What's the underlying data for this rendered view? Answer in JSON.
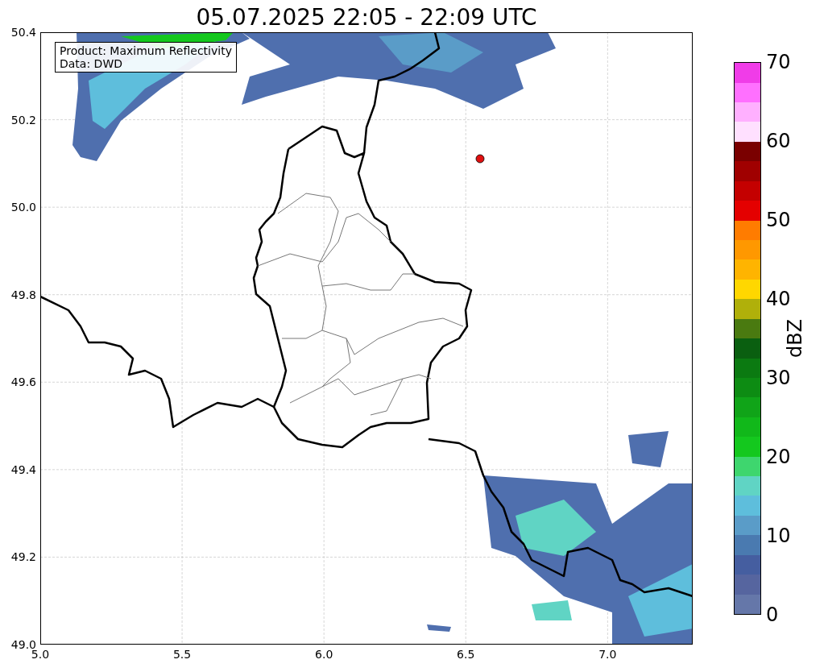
{
  "title": "05.07.2025 22:05 - 22:09 UTC",
  "legend": [
    "Product: Maximum Reflectivity",
    "Data: DWD"
  ],
  "map": {
    "xticks": [
      "5.0",
      "5.5",
      "6.0",
      "6.5",
      "7.0"
    ],
    "yticks": [
      "50.4",
      "50.2",
      "50.0",
      "49.8",
      "49.6",
      "49.4",
      "49.2",
      "49.0"
    ]
  },
  "colorbar": {
    "label": "dBZ",
    "ticks": [
      "70",
      "60",
      "50",
      "40",
      "30",
      "20",
      "10",
      "0"
    ],
    "bands": [
      {
        "color": "#6577a9"
      },
      {
        "color": "#56659f"
      },
      {
        "color": "#455ea0"
      },
      {
        "color": "#4a7ab0"
      },
      {
        "color": "#5a9cc8"
      },
      {
        "color": "#5ebedc"
      },
      {
        "color": "#60d4c4"
      },
      {
        "color": "#3ed66e"
      },
      {
        "color": "#14c81e"
      },
      {
        "color": "#11b81a"
      },
      {
        "color": "#10a418"
      },
      {
        "color": "#0d8c13"
      },
      {
        "color": "#0b7a11"
      },
      {
        "color": "#0a5f10"
      },
      {
        "color": "#4a7a10"
      },
      {
        "color": "#b0b00a"
      },
      {
        "color": "#ffd700"
      },
      {
        "color": "#ffb400"
      },
      {
        "color": "#ff9800"
      },
      {
        "color": "#ff7c00"
      },
      {
        "color": "#e40000"
      },
      {
        "color": "#c40000"
      },
      {
        "color": "#a00000"
      },
      {
        "color": "#7a0000"
      },
      {
        "color": "#ffe0ff"
      },
      {
        "color": "#ffb0ff"
      },
      {
        "color": "#ff70ff"
      },
      {
        "color": "#f03ce8"
      }
    ]
  }
}
